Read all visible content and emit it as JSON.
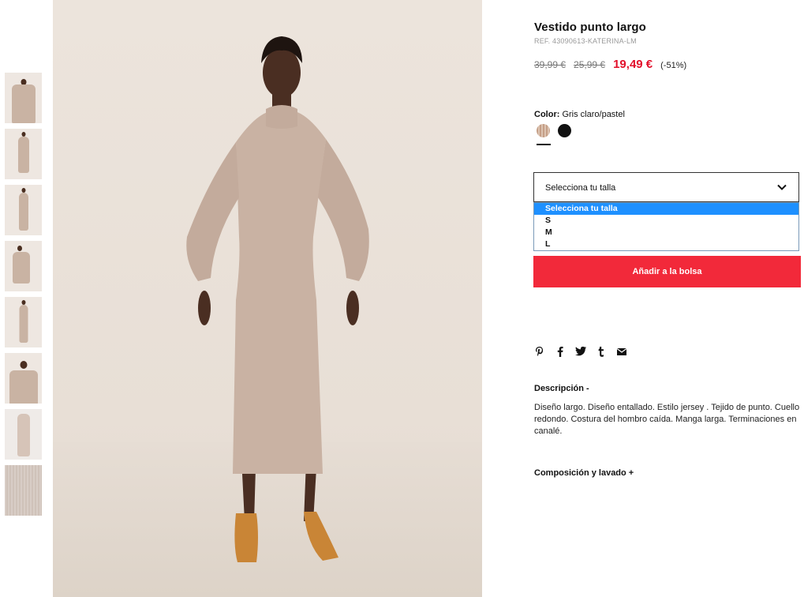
{
  "product": {
    "title": "Vestido punto largo",
    "ref": "REF. 43090613-KATERINA-LM",
    "price_original": "39,99 €",
    "price_previous": "25,99 €",
    "price_current": "19,49 €",
    "discount": "(-51%)",
    "accent_color": "#e2102b"
  },
  "color": {
    "label": "Color:",
    "value": "Gris claro/pastel",
    "swatches": [
      "beige-stripe",
      "black"
    ],
    "selected_index": 0
  },
  "size": {
    "placeholder": "Selecciona tu talla",
    "options": [
      "Selecciona tu talla",
      "S",
      "M",
      "L"
    ],
    "highlighted_index": 0
  },
  "cart": {
    "button_label": "Añadir a la bolsa",
    "button_color": "#f2293a"
  },
  "share_icons": [
    "pinterest-icon",
    "facebook-icon",
    "twitter-icon",
    "tumblr-icon",
    "mail-icon"
  ],
  "description": {
    "heading": "Descripción -",
    "text": "Diseño largo. Diseño entallado. Estilo jersey . Tejido de punto. Cuello redondo. Costura del hombro caída. Manga larga. Terminaciones en canalé."
  },
  "composition": {
    "heading": "Composición y lavado +"
  },
  "thumbnails": [
    "front-closeup",
    "full-front",
    "full-front-2",
    "seated",
    "side",
    "arms-up",
    "garment-flat",
    "fabric-texture"
  ]
}
